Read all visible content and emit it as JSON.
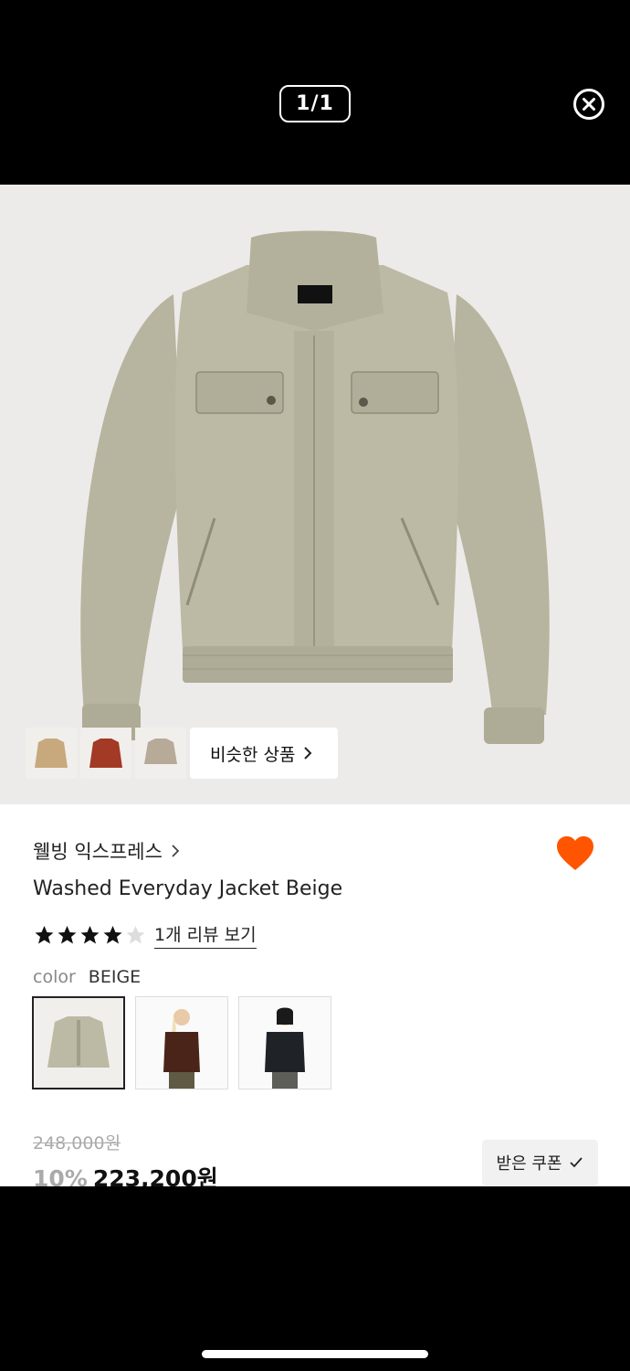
{
  "viewer": {
    "counter": "1/1"
  },
  "similar": {
    "label": "비슷한 상품"
  },
  "product": {
    "brand": "웰빙 익스프레스",
    "name": "Washed Everyday Jacket Beige",
    "rating": 4,
    "rating_max": 5,
    "review_link": "1개 리뷰 보기",
    "color_label": "color",
    "color_value": "BEIGE",
    "price_original": "248,000원",
    "discount": "10%",
    "price_final": "223,200원",
    "coupon_label": "받은 쿠폰"
  },
  "colors": {
    "accent_heart": "#ff5500",
    "jacket": "#bcb9a4"
  }
}
